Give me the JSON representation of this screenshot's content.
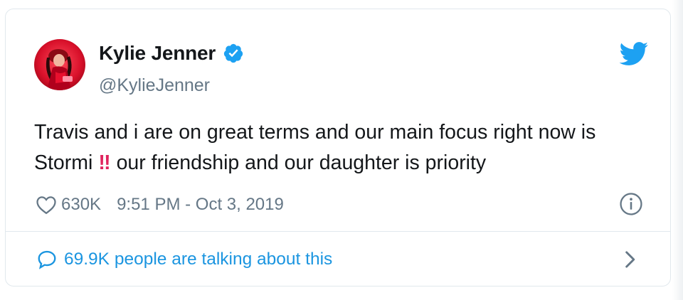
{
  "tweet": {
    "author": {
      "name": "Kylie Jenner",
      "handle": "@KylieJenner",
      "verified": true
    },
    "text_before_emoji": "Travis and i are on great terms and our main focus right now is Stormi",
    "emoji": "‼",
    "text_after_emoji": "our friendship and our daughter is priority",
    "likes": "630K",
    "timestamp": "9:51 PM - Oct 3, 2019",
    "talking": "69.9K people are talking about this"
  },
  "icons": {
    "heart": "heart-icon",
    "verified": "verified-badge-icon",
    "brand": "twitter-bird-icon",
    "info": "info-icon",
    "reply": "speech-bubble-icon",
    "chevron": "chevron-right-icon"
  },
  "colors": {
    "brand_blue": "#1da1f2",
    "link_blue": "#1b95e0",
    "text": "#14171a",
    "muted": "#657786",
    "emoji_red": "#e0245e",
    "border": "#e1e8ed"
  }
}
